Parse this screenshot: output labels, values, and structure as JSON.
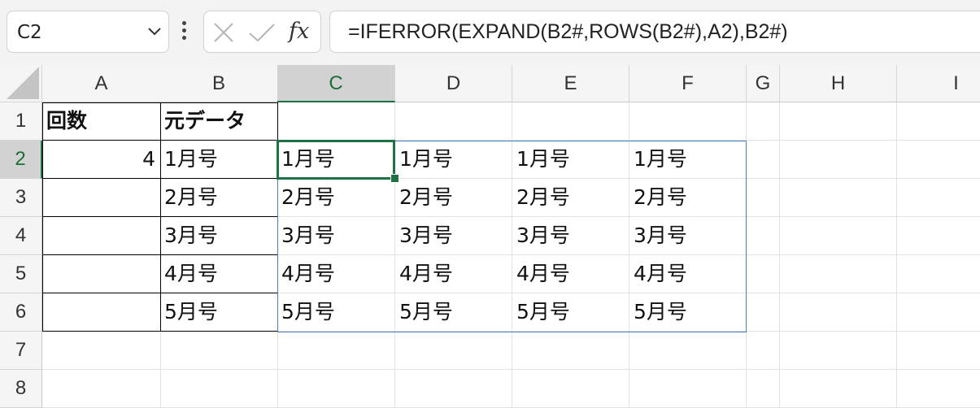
{
  "name_box": {
    "value": "C2"
  },
  "formula_bar": {
    "fx_label": "fx",
    "formula": "=IFERROR(EXPAND(B2#,ROWS(B2#),A2),B2#)"
  },
  "columns": [
    "A",
    "B",
    "C",
    "D",
    "E",
    "F",
    "G",
    "H",
    "I"
  ],
  "rows": [
    "1",
    "2",
    "3",
    "4",
    "5",
    "6",
    "7",
    "8"
  ],
  "selected_cell": "C2",
  "cells": {
    "A1": "回数",
    "B1": "元データ",
    "A2": "4",
    "B2": "1月号",
    "B3": "2月号",
    "B4": "3月号",
    "B5": "4月号",
    "B6": "5月号",
    "C2": "1月号",
    "D2": "1月号",
    "E2": "1月号",
    "F2": "1月号",
    "C3": "2月号",
    "D3": "2月号",
    "E3": "2月号",
    "F3": "2月号",
    "C4": "3月号",
    "D4": "3月号",
    "E4": "3月号",
    "F4": "3月号",
    "C5": "4月号",
    "D5": "4月号",
    "E5": "4月号",
    "F5": "4月号",
    "C6": "5月号",
    "D6": "5月号",
    "E6": "5月号",
    "F6": "5月号"
  },
  "colors": {
    "accent_green": "#1e7145",
    "spill_border": "#4a7ec2"
  }
}
